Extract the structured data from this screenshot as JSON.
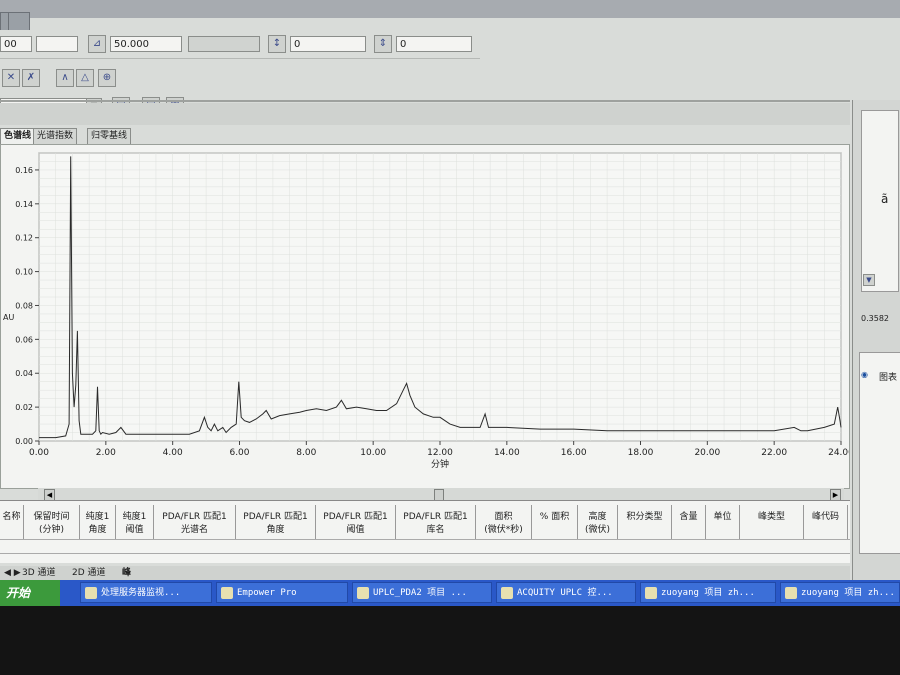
{
  "toolbar": {
    "field1": "00",
    "field2": "",
    "scale_value": "50.000",
    "field4": "",
    "field5": "0",
    "field6": "0"
  },
  "tabs": [
    {
      "label": "色谱线",
      "active": true
    },
    {
      "label": "光谱指数",
      "active": false
    },
    {
      "label": "归零基线",
      "active": false
    }
  ],
  "right_panel": {
    "value_readout": "0.3582",
    "unit_char": "ã",
    "legend_label": "图表"
  },
  "table": {
    "columns": [
      {
        "label": "名称"
      },
      {
        "label": "保留时间\n(分钟)"
      },
      {
        "label": "纯度1\n角度"
      },
      {
        "label": "纯度1\n阈值"
      },
      {
        "label": "PDA/FLR 匹配1\n光谱名"
      },
      {
        "label": "PDA/FLR 匹配1\n角度"
      },
      {
        "label": "PDA/FLR 匹配1\n阈值"
      },
      {
        "label": "PDA/FLR 匹配1\n库名"
      },
      {
        "label": "面积\n(微伏*秒)"
      },
      {
        "label": "% 面积"
      },
      {
        "label": "高度\n(微伏)"
      },
      {
        "label": "积分类型"
      },
      {
        "label": "含量"
      },
      {
        "label": "单位"
      },
      {
        "label": "峰类型"
      },
      {
        "label": "峰代码"
      }
    ]
  },
  "bottom_tabs": [
    {
      "label": "3D 通道"
    },
    {
      "label": "2D 通道"
    },
    {
      "label": "峰"
    }
  ],
  "taskbar": {
    "start_label": "开始",
    "tasks": [
      {
        "label": "处理服务器监视..."
      },
      {
        "label": "Empower Pro"
      },
      {
        "label": "UPLC_PDA2 项目 ..."
      },
      {
        "label": "ACQUITY UPLC 控..."
      },
      {
        "label": "zuoyang 项目 zh..."
      },
      {
        "label": "zuoyang 项目 zh..."
      }
    ]
  },
  "chart_data": {
    "type": "line",
    "xlabel": "分钟",
    "ylabel": "AU",
    "xlim": [
      0,
      24
    ],
    "ylim": [
      0,
      0.17
    ],
    "x_ticks": [
      "0.00",
      "2.00",
      "4.00",
      "6.00",
      "8.00",
      "10.00",
      "12.00",
      "14.00",
      "16.00",
      "18.00",
      "20.00",
      "22.00",
      "24.00"
    ],
    "y_ticks": [
      "0.00",
      "0.02",
      "0.04",
      "0.06",
      "0.08",
      "0.10",
      "0.12",
      "0.14",
      "0.16"
    ],
    "grid": true,
    "color": "#2a2a2a",
    "series": [
      {
        "x": [
          0.0,
          0.5,
          0.8,
          0.9,
          0.95,
          1.0,
          1.05,
          1.1,
          1.15,
          1.2,
          1.25,
          1.3,
          1.4,
          1.6,
          1.7,
          1.75,
          1.8,
          1.85,
          1.9,
          2.1,
          2.3,
          2.45,
          2.6,
          3.0,
          3.5,
          4.0,
          4.5,
          4.8,
          4.95,
          5.05,
          5.15,
          5.25,
          5.35,
          5.5,
          5.6,
          5.75,
          5.9,
          5.98,
          6.05,
          6.15,
          6.3,
          6.5,
          6.7,
          6.8,
          6.95,
          7.2,
          7.5,
          7.8,
          8.0,
          8.3,
          8.6,
          8.9,
          9.05,
          9.2,
          9.5,
          9.8,
          10.1,
          10.4,
          10.7,
          10.9,
          11.0,
          11.1,
          11.25,
          11.5,
          11.8,
          12.0,
          12.3,
          12.6,
          12.9,
          13.2,
          13.35,
          13.45,
          13.6,
          14.0,
          15.0,
          16.0,
          17.0,
          18.0,
          19.0,
          20.0,
          21.0,
          22.0,
          22.6,
          22.8,
          23.0,
          23.5,
          23.8,
          23.9,
          23.97,
          24.0
        ],
        "y": [
          0.002,
          0.002,
          0.003,
          0.01,
          0.168,
          0.04,
          0.02,
          0.033,
          0.065,
          0.012,
          0.004,
          0.004,
          0.004,
          0.004,
          0.006,
          0.032,
          0.006,
          0.004,
          0.005,
          0.004,
          0.005,
          0.008,
          0.004,
          0.004,
          0.004,
          0.004,
          0.004,
          0.006,
          0.014,
          0.008,
          0.006,
          0.01,
          0.006,
          0.008,
          0.005,
          0.008,
          0.01,
          0.035,
          0.014,
          0.012,
          0.011,
          0.013,
          0.016,
          0.018,
          0.013,
          0.015,
          0.016,
          0.017,
          0.018,
          0.019,
          0.018,
          0.02,
          0.024,
          0.019,
          0.02,
          0.019,
          0.018,
          0.018,
          0.022,
          0.03,
          0.034,
          0.027,
          0.02,
          0.016,
          0.014,
          0.014,
          0.01,
          0.008,
          0.008,
          0.008,
          0.016,
          0.008,
          0.008,
          0.008,
          0.007,
          0.007,
          0.006,
          0.006,
          0.006,
          0.006,
          0.006,
          0.006,
          0.008,
          0.006,
          0.006,
          0.008,
          0.01,
          0.02,
          0.012,
          0.008
        ]
      }
    ]
  }
}
